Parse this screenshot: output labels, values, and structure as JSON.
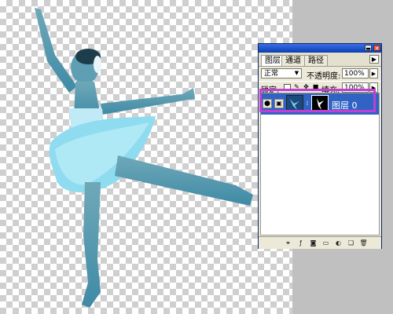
{
  "panel": {
    "tabs": [
      {
        "label": "图层",
        "active": true
      },
      {
        "label": "通道",
        "active": false
      },
      {
        "label": "路径",
        "active": false
      }
    ],
    "blend_mode": "正常",
    "opacity_label": "不透明度:",
    "opacity_value": "100%",
    "lock_label": "锁定:",
    "fill_label": "填充:",
    "fill_value": "100%",
    "layers": [
      {
        "name": "图层 0",
        "visible": true,
        "selected": true
      }
    ],
    "bottom_icons": [
      "link-layers-icon",
      "layer-style-icon",
      "add-mask-icon",
      "new-group-icon",
      "adjustment-layer-icon",
      "new-layer-icon",
      "delete-layer-icon"
    ]
  },
  "colors": {
    "selection": "#3163c5",
    "highlight": "#c040d0",
    "panel_bg": "#ece9d8",
    "pasteboard": "#c0c0c0",
    "dancer": "#5cc8e0"
  }
}
